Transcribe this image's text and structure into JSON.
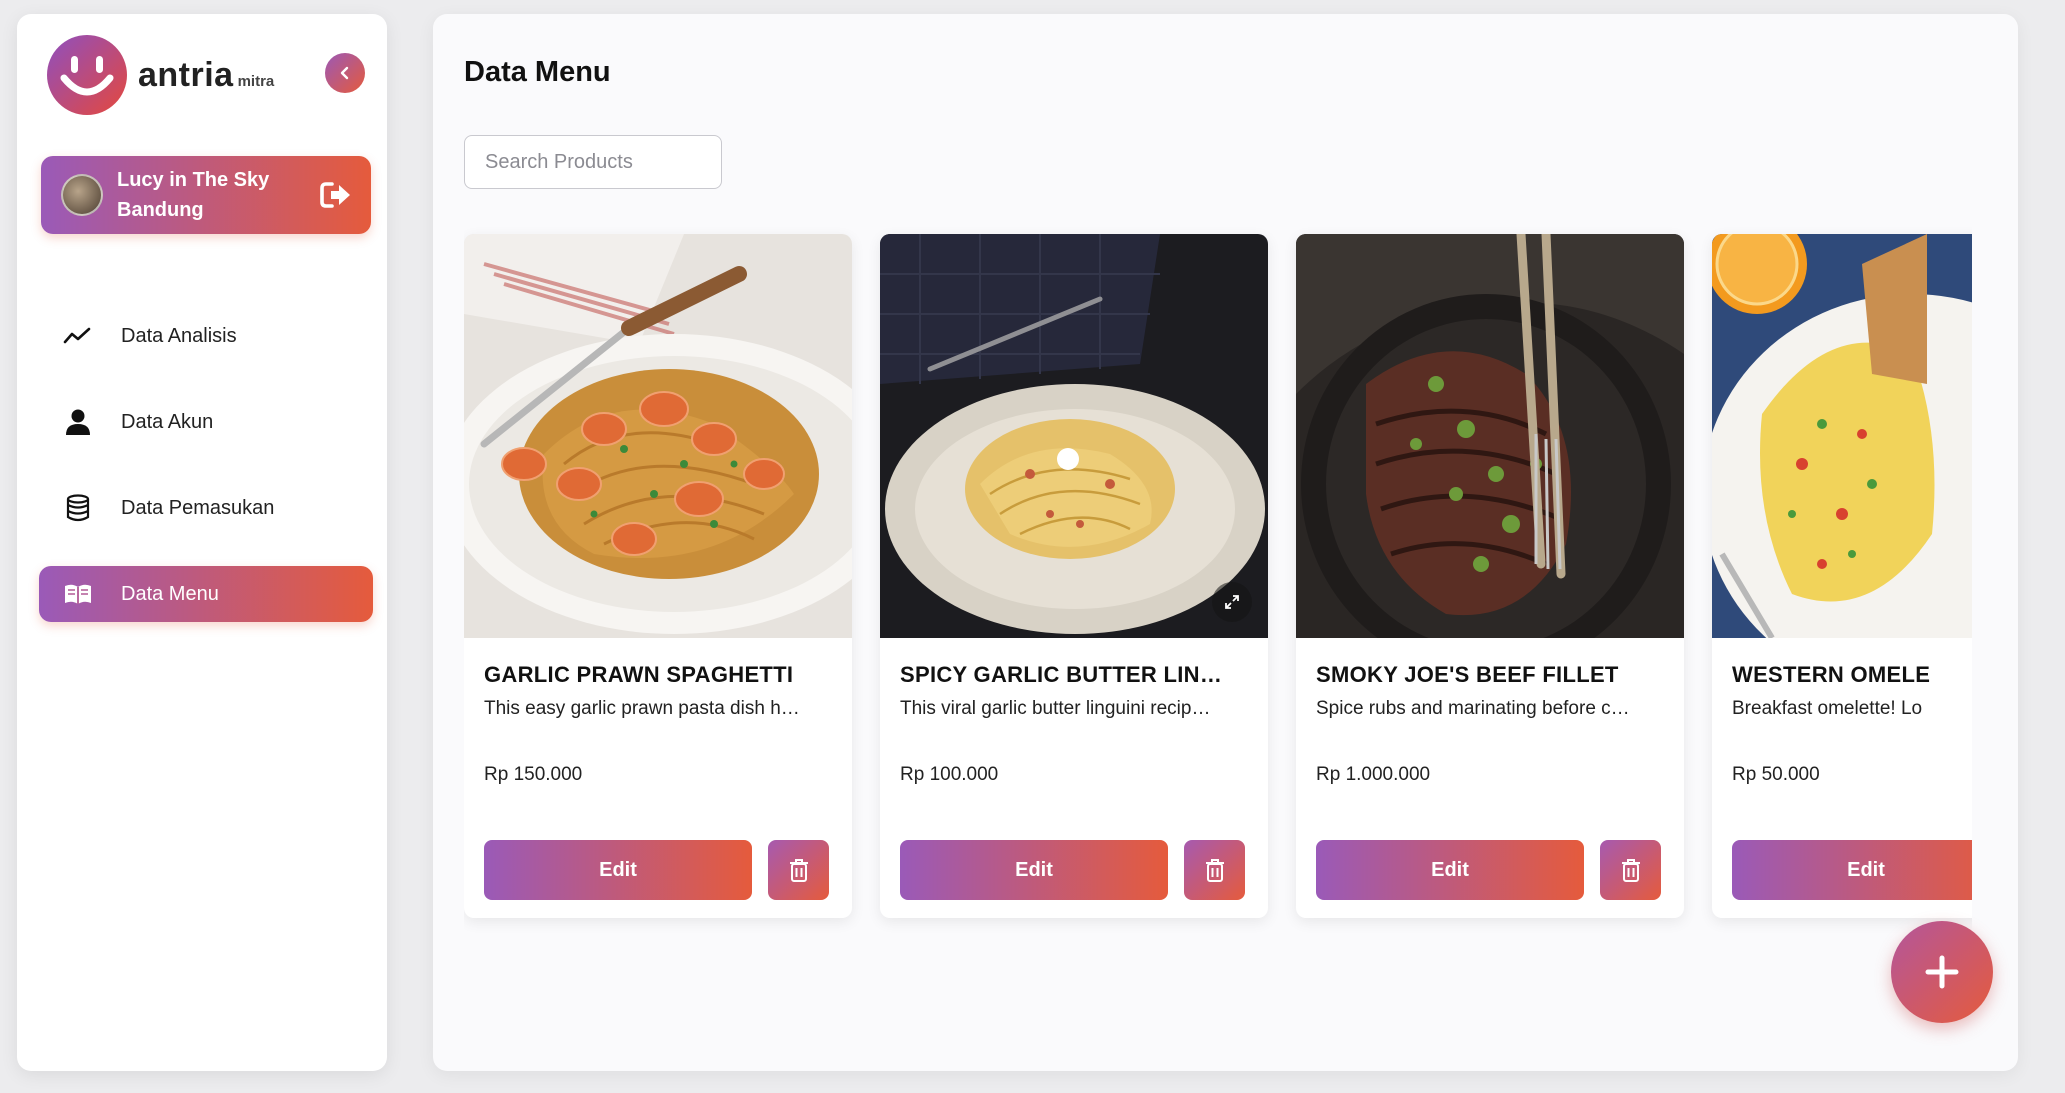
{
  "brand": {
    "name": "antria",
    "sub": "mitra"
  },
  "colors": {
    "gradient_start": "#9a5ab8",
    "gradient_end": "#e55b3c"
  },
  "store": {
    "line1": "Lucy in The Sky",
    "line2": "Bandung"
  },
  "nav": [
    {
      "label": "Data Analisis",
      "icon": "line-chart-icon",
      "active": false
    },
    {
      "label": "Data Akun",
      "icon": "user-icon",
      "active": false
    },
    {
      "label": "Data Pemasukan",
      "icon": "coins-stack-icon",
      "active": false
    },
    {
      "label": "Data Menu",
      "icon": "book-icon",
      "active": true
    }
  ],
  "page": {
    "title": "Data Menu"
  },
  "search": {
    "placeholder": "Search Products",
    "value": ""
  },
  "products": [
    {
      "title": "GARLIC PRAWN SPAGHETTI",
      "description": "This easy garlic prawn pasta dish h…",
      "price": "Rp 150.000",
      "edit_label": "Edit"
    },
    {
      "title": "SPICY GARLIC BUTTER LIN…",
      "description": "This viral garlic butter linguini recip…",
      "price": "Rp 100.000",
      "edit_label": "Edit"
    },
    {
      "title": "SMOKY JOE'S BEEF FILLET",
      "description": "Spice rubs and marinating before c…",
      "price": "Rp 1.000.000",
      "edit_label": "Edit"
    },
    {
      "title": "WESTERN OMELE",
      "description": "Breakfast omelette! Lo",
      "price": "Rp 50.000",
      "edit_label": "Edit"
    }
  ]
}
